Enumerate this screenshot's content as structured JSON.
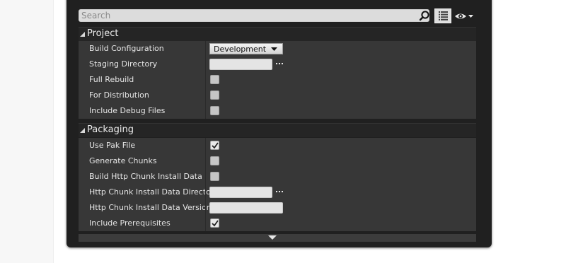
{
  "search": {
    "placeholder": "Search"
  },
  "icons": {
    "search": "search-icon",
    "view_options": "view-list-icon",
    "visibility": "eye-icon",
    "collapse": "triangle-down-icon",
    "scroll_more": "chevron-down-icon"
  },
  "sections": {
    "project": {
      "title": "Project",
      "build_configuration": {
        "label": "Build Configuration",
        "value": "Development"
      },
      "staging_directory": {
        "label": "Staging Directory",
        "value": ""
      },
      "full_rebuild": {
        "label": "Full Rebuild",
        "checked": false
      },
      "for_distribution": {
        "label": "For Distribution",
        "checked": false
      },
      "include_debug_files": {
        "label": "Include Debug Files",
        "checked": false
      }
    },
    "packaging": {
      "title": "Packaging",
      "use_pak_file": {
        "label": "Use Pak File",
        "checked": true
      },
      "generate_chunks": {
        "label": "Generate Chunks",
        "checked": false
      },
      "build_http_chunk_install_data": {
        "label": "Build Http Chunk Install Data",
        "checked": false
      },
      "http_chunk_install_data_directory": {
        "label": "Http Chunk Install Data Directory",
        "value": ""
      },
      "http_chunk_install_data_version": {
        "label": "Http Chunk Install Data Version",
        "value": ""
      },
      "include_prerequisites": {
        "label": "Include Prerequisites",
        "checked": true
      }
    }
  },
  "colors": {
    "panel_bg": "#202020",
    "row_bg": "#373737",
    "header_bg": "#252525",
    "text": "#e6e6e6"
  }
}
